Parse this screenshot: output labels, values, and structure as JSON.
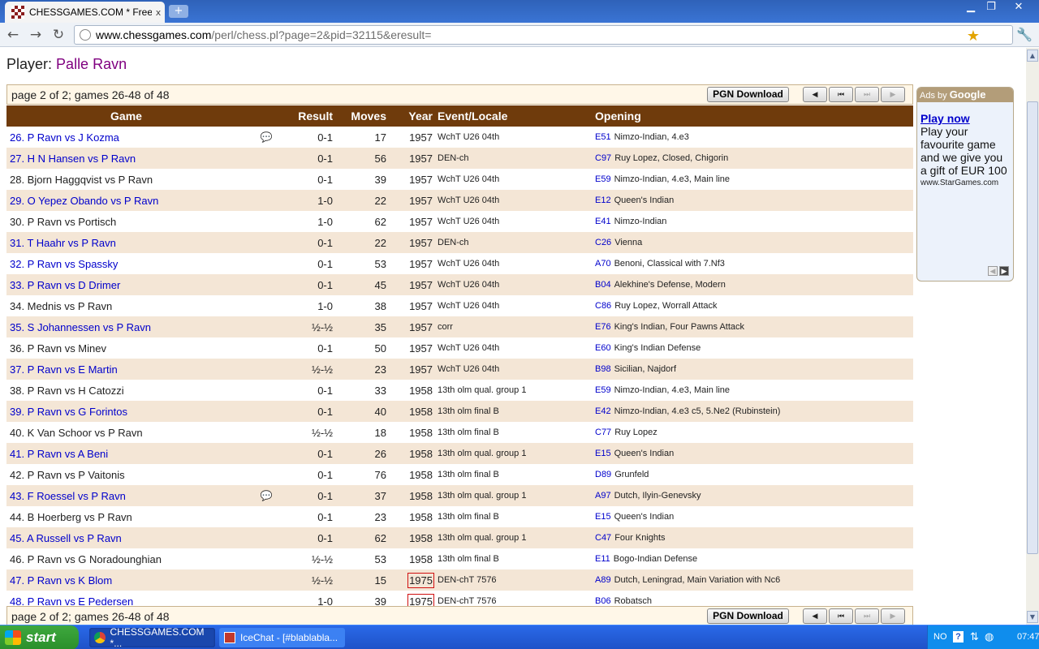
{
  "browser": {
    "tab_title": "CHESSGAMES.COM * Free ...",
    "tab_close": "x",
    "new_tab": "+",
    "url_host": "www.chessgames.com",
    "url_path": "/perl/chess.pl?page=2&pid=32115&eresult=",
    "win_min": "▁",
    "win_max": "❐",
    "win_close": "✕",
    "back": "←",
    "forward": "→",
    "reload": "↻",
    "bookmark": "★",
    "wrench": "🔧"
  },
  "page": {
    "player_label": "Player:",
    "player_name": "Palle Ravn",
    "page_info_top": "page 2 of 2; games 26-48 of 48",
    "page_info_bottom": "page 2 of 2; games 26-48 of 48",
    "pgn_download": "PGN Download",
    "nav_prev": "◀",
    "nav_first": "⏮",
    "nav_last": "⏭",
    "nav_next": "▶"
  },
  "table": {
    "headers": {
      "game": "Game",
      "result": "Result",
      "moves": "Moves",
      "year": "Year",
      "event": "Event/Locale",
      "opening": "Opening"
    },
    "rows": [
      {
        "game": "26. P Ravn vs J Kozma",
        "kib": "💬",
        "result": "0-1",
        "moves": "17",
        "year": "1957",
        "event": "WchT U26 04th",
        "eco": "E51",
        "opening": "Nimzo-Indian, 4.e3"
      },
      {
        "game": "27. H N Hansen vs P Ravn",
        "kib": "",
        "result": "0-1",
        "moves": "56",
        "year": "1957",
        "event": "DEN-ch",
        "eco": "C97",
        "opening": "Ruy Lopez, Closed, Chigorin"
      },
      {
        "game": "28. Bjorn Haggqvist vs P Ravn",
        "kib": "",
        "result": "0-1",
        "moves": "39",
        "year": "1957",
        "event": "WchT U26 04th",
        "eco": "E59",
        "opening": "Nimzo-Indian, 4.e3, Main line"
      },
      {
        "game": "29. O Yepez Obando vs P Ravn",
        "kib": "",
        "result": "1-0",
        "moves": "22",
        "year": "1957",
        "event": "WchT U26 04th",
        "eco": "E12",
        "opening": "Queen's Indian"
      },
      {
        "game": "30. P Ravn vs Portisch",
        "kib": "",
        "result": "1-0",
        "moves": "62",
        "year": "1957",
        "event": "WchT U26 04th",
        "eco": "E41",
        "opening": "Nimzo-Indian"
      },
      {
        "game": "31. T Haahr vs P Ravn",
        "kib": "",
        "result": "0-1",
        "moves": "22",
        "year": "1957",
        "event": "DEN-ch",
        "eco": "C26",
        "opening": "Vienna"
      },
      {
        "game": "32. P Ravn vs Spassky",
        "kib": "",
        "result": "0-1",
        "moves": "53",
        "year": "1957",
        "event": "WchT U26 04th",
        "eco": "A70",
        "opening": "Benoni, Classical with 7.Nf3"
      },
      {
        "game": "33. P Ravn vs D Drimer",
        "kib": "",
        "result": "0-1",
        "moves": "45",
        "year": "1957",
        "event": "WchT U26 04th",
        "eco": "B04",
        "opening": "Alekhine's Defense, Modern"
      },
      {
        "game": "34. Mednis vs P Ravn",
        "kib": "",
        "result": "1-0",
        "moves": "38",
        "year": "1957",
        "event": "WchT U26 04th",
        "eco": "C86",
        "opening": "Ruy Lopez, Worrall Attack"
      },
      {
        "game": "35. S Johannessen vs P Ravn",
        "kib": "",
        "result": "½-½",
        "moves": "35",
        "year": "1957",
        "event": "corr",
        "eco": "E76",
        "opening": "King's Indian, Four Pawns Attack"
      },
      {
        "game": "36. P Ravn vs Minev",
        "kib": "",
        "result": "0-1",
        "moves": "50",
        "year": "1957",
        "event": "WchT U26 04th",
        "eco": "E60",
        "opening": "King's Indian Defense"
      },
      {
        "game": "37. P Ravn vs E Martin",
        "kib": "",
        "result": "½-½",
        "moves": "23",
        "year": "1957",
        "event": "WchT U26 04th",
        "eco": "B98",
        "opening": "Sicilian, Najdorf"
      },
      {
        "game": "38. P Ravn vs H Catozzi",
        "kib": "",
        "result": "0-1",
        "moves": "33",
        "year": "1958",
        "event": "13th olm qual. group 1",
        "eco": "E59",
        "opening": "Nimzo-Indian, 4.e3, Main line"
      },
      {
        "game": "39. P Ravn vs G Forintos",
        "kib": "",
        "result": "0-1",
        "moves": "40",
        "year": "1958",
        "event": "13th olm final B",
        "eco": "E42",
        "opening": "Nimzo-Indian, 4.e3 c5, 5.Ne2 (Rubinstein)"
      },
      {
        "game": "40. K Van Schoor vs P Ravn",
        "kib": "",
        "result": "½-½",
        "moves": "18",
        "year": "1958",
        "event": "13th olm final B",
        "eco": "C77",
        "opening": "Ruy Lopez"
      },
      {
        "game": "41. P Ravn vs A Beni",
        "kib": "",
        "result": "0-1",
        "moves": "26",
        "year": "1958",
        "event": "13th olm qual. group 1",
        "eco": "E15",
        "opening": "Queen's Indian"
      },
      {
        "game": "42. P Ravn vs P Vaitonis",
        "kib": "",
        "result": "0-1",
        "moves": "76",
        "year": "1958",
        "event": "13th olm final B",
        "eco": "D89",
        "opening": "Grunfeld"
      },
      {
        "game": "43. F Roessel vs P Ravn",
        "kib": "💬",
        "result": "0-1",
        "moves": "37",
        "year": "1958",
        "event": "13th olm qual. group 1",
        "eco": "A97",
        "opening": "Dutch, Ilyin-Genevsky"
      },
      {
        "game": "44. B Hoerberg vs P Ravn",
        "kib": "",
        "result": "0-1",
        "moves": "23",
        "year": "1958",
        "event": "13th olm final B",
        "eco": "E15",
        "opening": "Queen's Indian"
      },
      {
        "game": "45. A Russell vs P Ravn",
        "kib": "",
        "result": "0-1",
        "moves": "62",
        "year": "1958",
        "event": "13th olm qual. group 1",
        "eco": "C47",
        "opening": "Four Knights"
      },
      {
        "game": "46. P Ravn vs G Noradounghian",
        "kib": "",
        "result": "½-½",
        "moves": "53",
        "year": "1958",
        "event": "13th olm final B",
        "eco": "E11",
        "opening": "Bogo-Indian Defense"
      },
      {
        "game": "47. P Ravn vs K Blom",
        "kib": "",
        "result": "½-½",
        "moves": "15",
        "year": "1975",
        "event": "DEN-chT 7576",
        "eco": "A89",
        "opening": "Dutch, Leningrad, Main Variation with Nc6"
      },
      {
        "game": "48. P Ravn vs E Pedersen",
        "kib": "",
        "result": "1-0",
        "moves": "39",
        "year": "1975",
        "event": "DEN-chT 7576",
        "eco": "B06",
        "opening": "Robatsch"
      }
    ]
  },
  "ad": {
    "head_prefix": "Ads by ",
    "head_brand": "Google",
    "title": "Play now",
    "text": "Play your favourite game and we give you a gift of EUR 100",
    "url": "www.StarGames.com",
    "prev": "◀",
    "next": "▶"
  },
  "taskbar": {
    "start": "start",
    "task1": "CHESSGAMES.COM *...",
    "task2": "IceChat - [#blablabla...",
    "lang": "NO",
    "help": "?",
    "clock": "07:47"
  }
}
